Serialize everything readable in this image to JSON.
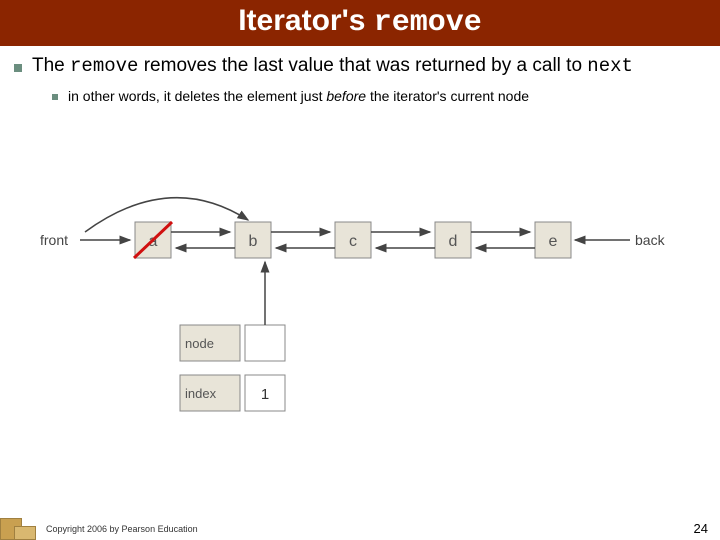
{
  "title": {
    "pre": "Iterator's ",
    "code": "remove"
  },
  "main_bullet": {
    "p1": "The ",
    "c1": "remove",
    "p2": " removes the last value that was returned by a call to ",
    "c2": "next"
  },
  "sub_bullet": {
    "p1": "in other words, it deletes the element just ",
    "em": "before",
    "p2": " the iterator's current node"
  },
  "diagram": {
    "front": "front",
    "back": "back",
    "nodes": [
      "a",
      "b",
      "c",
      "d",
      "e"
    ],
    "node_label": "node",
    "index_label": "index",
    "index_value": "1"
  },
  "footer": "Copyright 2006 by Pearson Education",
  "page_number": "24"
}
